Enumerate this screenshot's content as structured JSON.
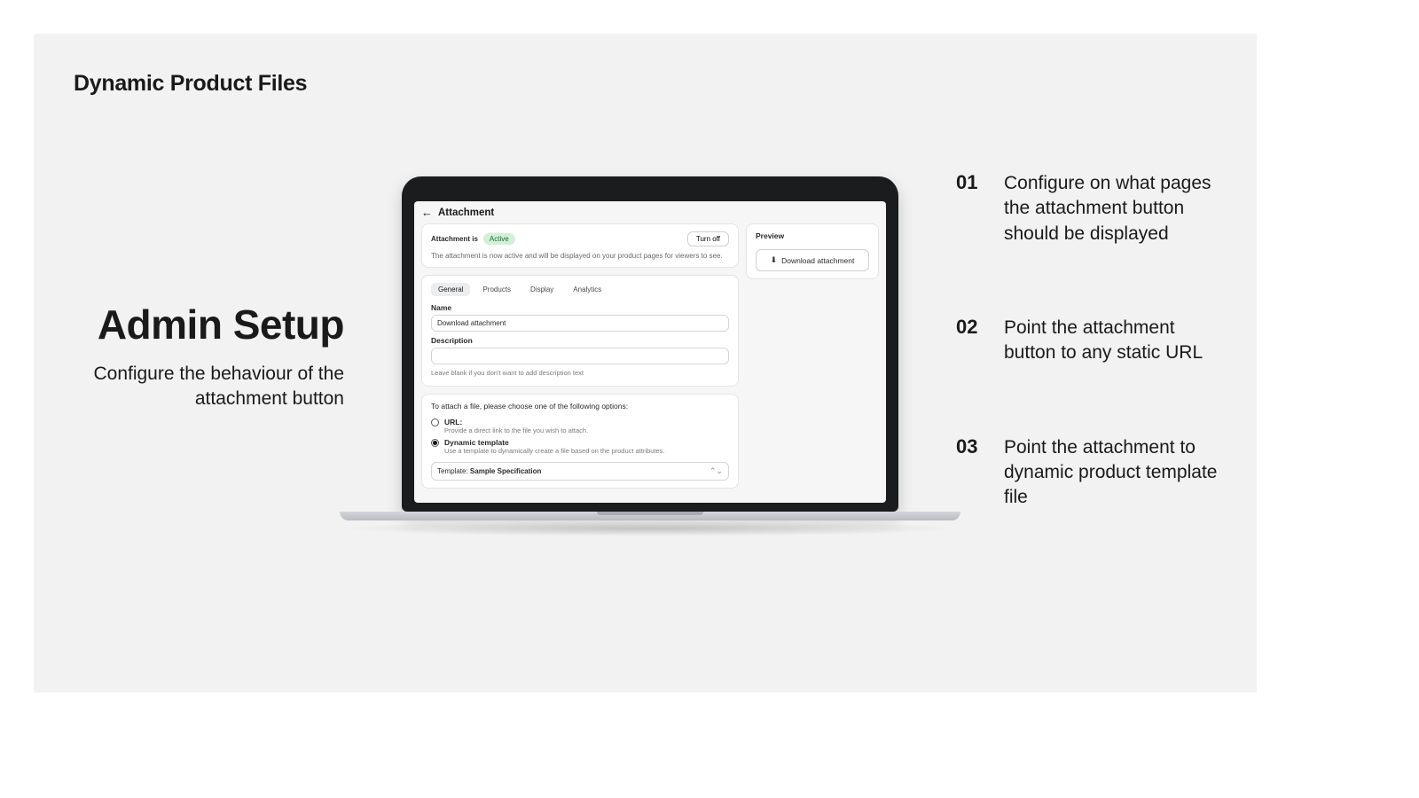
{
  "brand": "Dynamic Product Files",
  "left": {
    "title": "Admin Setup",
    "subtitle": "Configure the behaviour of the attachment button"
  },
  "features": [
    {
      "num": "01",
      "text": "Configure on what pages the attachment button should be displayed"
    },
    {
      "num": "02",
      "text": "Point the attachment button to any static URL"
    },
    {
      "num": "03",
      "text": "Point the attachment to dynamic product template file"
    }
  ],
  "screen": {
    "title": "Attachment",
    "status": {
      "label": "Attachment is",
      "badge": "Active",
      "turn_off": "Turn off",
      "desc": "The attachment is now active and will be displayed on your product pages for viewers to see."
    },
    "tabs": [
      "General",
      "Products",
      "Display",
      "Analytics"
    ],
    "name_label": "Name",
    "name_value": "Download attachment",
    "desc_label": "Description",
    "desc_value": "",
    "desc_hint": "Leave blank if you don't want to add description text",
    "attach_heading": "To attach a file, please choose one of the following options:",
    "url_option": {
      "label": "URL:",
      "desc": "Provide a direct link to the file you wish to attach."
    },
    "dyn_option": {
      "label": "Dynamic template",
      "desc": "Use a template to dynamically create a file based on the product attributes."
    },
    "template_label": "Template:",
    "template_value": "Sample Specification",
    "preview": {
      "label": "Preview",
      "button": "Download attachment"
    }
  }
}
